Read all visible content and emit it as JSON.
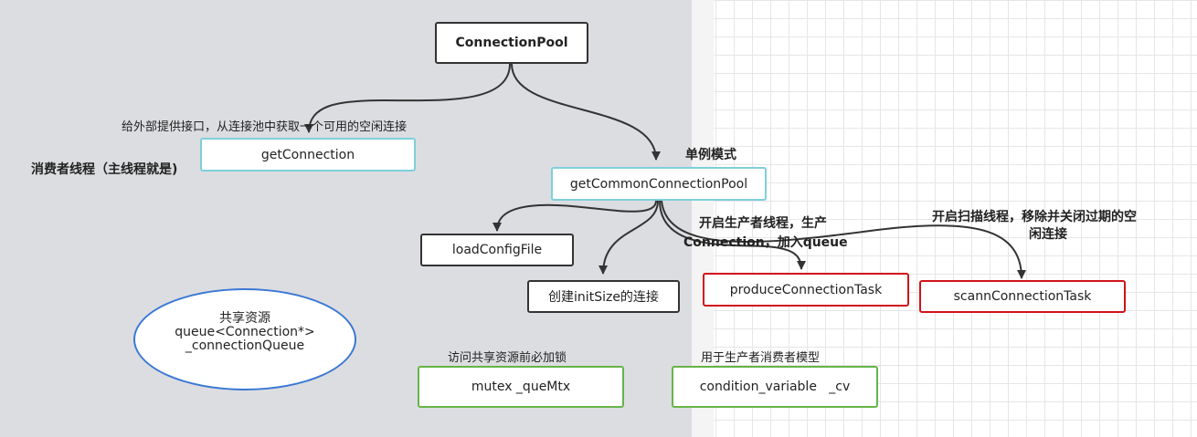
{
  "nodes": {
    "connection_pool": "ConnectionPool",
    "get_connection": "getConnection",
    "get_common_pool": "getCommonConnectionPool",
    "load_config": "loadConfigFile",
    "create_init": "创建initSize的连接",
    "produce_task": "produceConnectionTask",
    "scann_task": "scannConnectionTask",
    "mutex": "mutex _queMtx",
    "condvar": "condition_variable   _cv"
  },
  "labels": {
    "get_connection_desc": "给外部提供接口，从连接池中获取一个可用的空闲连接",
    "consumer_thread": "消费者线程（主线程就是)",
    "singleton": "单例模式",
    "producer_line1": "开启生产者线程，生产",
    "producer_line2": "Connection，加入queue",
    "scanner_line1": "开启扫描线程，移除并关闭过期的空",
    "scanner_line2": "闲连接",
    "lock_desc": "访问共享资源前必加锁",
    "prod_cons_model": "用于生产者消费者模型"
  },
  "shared_resource": {
    "title": "共享资源",
    "type": "queue<Connection*>",
    "name": "_connectionQueue"
  },
  "colors": {
    "canvas_left": "#dcdde1",
    "dark_border": "#333333",
    "cyan_border": "#7ecfdc",
    "red_border": "#d0121b",
    "green_border": "#66b447",
    "blue_border": "#3b78d4"
  }
}
